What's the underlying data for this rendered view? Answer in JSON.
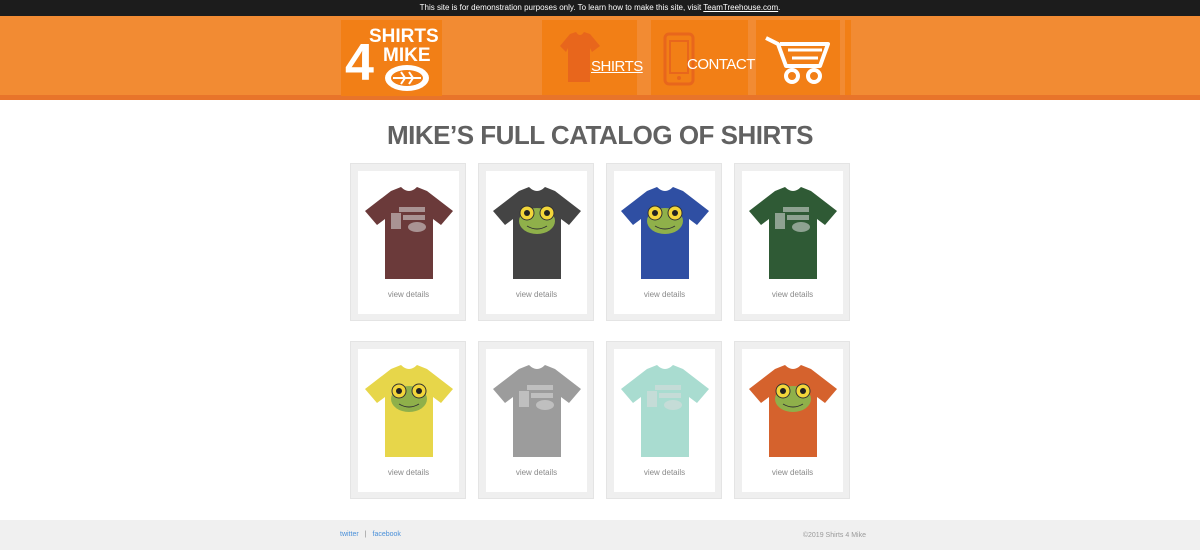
{
  "notice": {
    "text": "This site is for demonstration purposes only. To learn how to make this site, visit ",
    "link": "TeamTreehouse.com",
    "suffix": "."
  },
  "header": {
    "logo_text": [
      "SHIRTS",
      "4",
      "MIKE"
    ],
    "nav": {
      "shirts": "SHIRTS",
      "contact": "CONTACT",
      "cart_icon": "cart-icon"
    }
  },
  "page_title": "MIKE’S FULL CATALOG OF SHIRTS",
  "products": [
    {
      "color": "#6b3a3a",
      "graphic": "logo-print",
      "link": "view details"
    },
    {
      "color": "#444444",
      "graphic": "frog-face",
      "link": "view details"
    },
    {
      "color": "#2f4fa3",
      "graphic": "frog-face",
      "link": "view details"
    },
    {
      "color": "#2f5a35",
      "graphic": "logo-print",
      "link": "view details"
    },
    {
      "color": "#e7d64a",
      "graphic": "frog-face",
      "link": "view details"
    },
    {
      "color": "#9c9c9c",
      "graphic": "logo-print",
      "link": "view details"
    },
    {
      "color": "#a9dcd0",
      "graphic": "logo-print",
      "link": "view details"
    },
    {
      "color": "#d5622d",
      "graphic": "frog-face",
      "link": "view details"
    }
  ],
  "footer": {
    "twitter": "twitter",
    "separator": "|",
    "facebook": "facebook",
    "copyright": "©2019 Shirts 4 Mike"
  },
  "colors": {
    "header_orange": "#f28b33",
    "tile_orange": "#f27f16",
    "footer_bg": "#f0f0f0",
    "title_gray": "#616161"
  }
}
